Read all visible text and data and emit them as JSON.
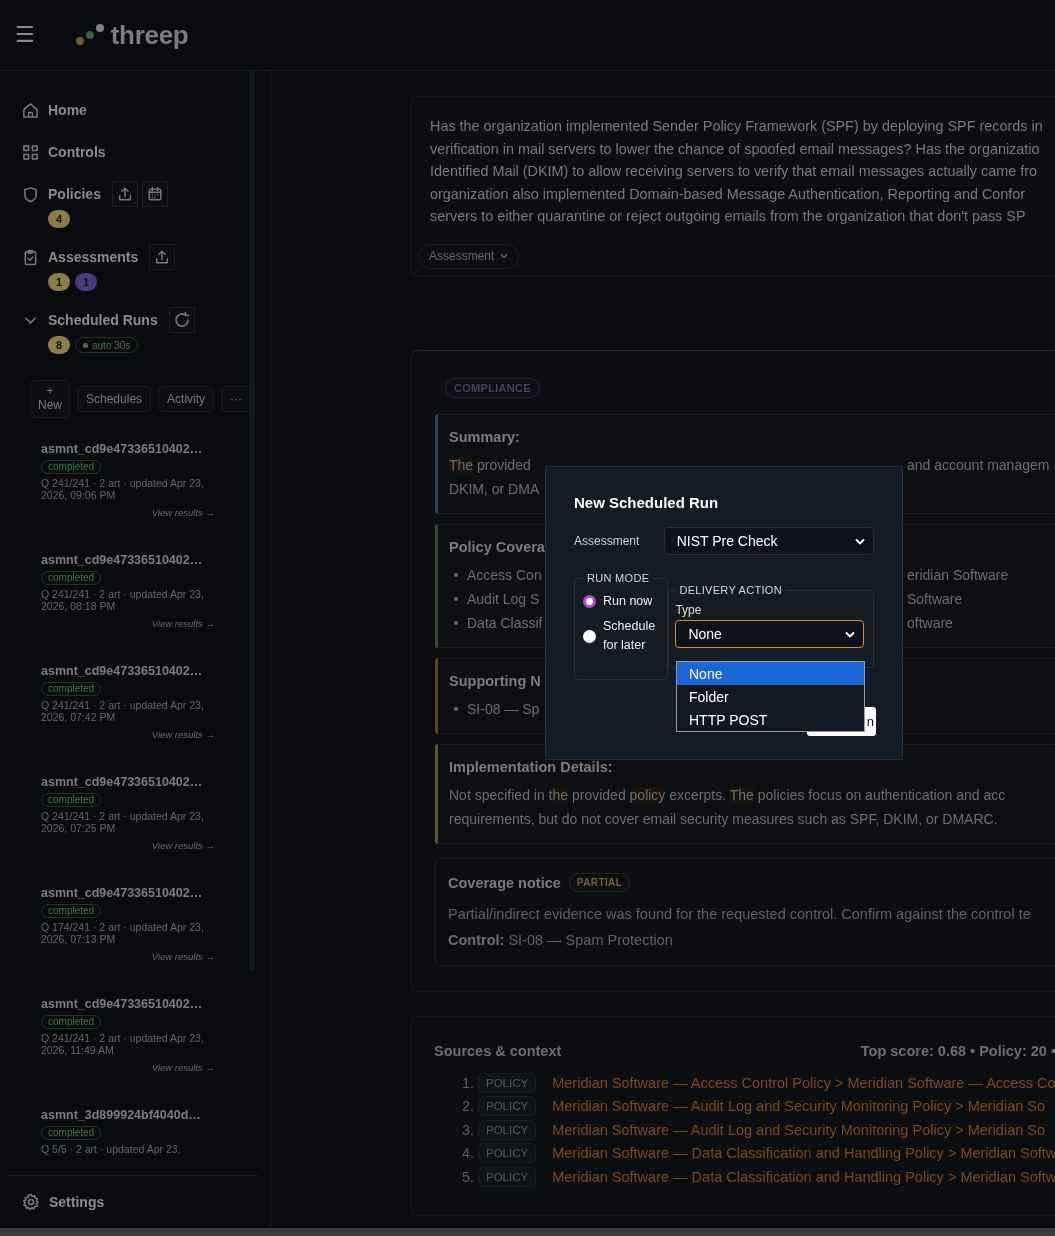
{
  "header": {
    "menu": "☰",
    "logo": "threep"
  },
  "sidebar": {
    "nav": [
      {
        "kind": "home",
        "label": "Home"
      },
      {
        "kind": "grid",
        "label": "Controls"
      },
      {
        "kind": "shield",
        "label": "Policies",
        "actions": [
          {
            "kind": "upload"
          },
          {
            "kind": "calendar"
          }
        ],
        "badges": [
          {
            "text": "4",
            "color": "#8c7c48"
          }
        ]
      },
      {
        "kind": "clipboard",
        "label": "Assessments",
        "actions": [
          {
            "kind": "upload"
          }
        ],
        "badges": [
          {
            "text": "1",
            "color": "#8c7c48"
          },
          {
            "text": "1",
            "color": "#4c3a7c"
          }
        ]
      },
      {
        "kind": "chevron",
        "label": "Scheduled Runs",
        "expanded": true,
        "actions": [
          {
            "kind": "refresh"
          }
        ],
        "badges": [
          {
            "text": "8",
            "color": "#8c7c48"
          }
        ],
        "status": "auto 30s"
      }
    ],
    "tabs": [
      {
        "icon": "+",
        "label": "New"
      },
      {
        "label": "Schedules"
      },
      {
        "label": "Activity"
      },
      {
        "label": "···"
      }
    ],
    "runs": [
      {
        "title": "asmnt_cd9e47336510402…",
        "status": "completed",
        "meta": "Q 241/241 · 2 art · updated Apr 23, 2026, 09:06 PM",
        "link": "View results →"
      },
      {
        "title": "asmnt_cd9e47336510402…",
        "status": "completed",
        "meta": "Q 241/241 · 2 art · updated Apr 23, 2026, 08:18 PM",
        "link": "View results →"
      },
      {
        "title": "asmnt_cd9e47336510402…",
        "status": "completed",
        "meta": "Q 241/241 · 2 art · updated Apr 23, 2026, 07:42 PM",
        "link": "View results →"
      },
      {
        "title": "asmnt_cd9e47336510402…",
        "status": "completed",
        "meta": "Q 241/241 · 2 art · updated Apr 23, 2026, 07:25 PM",
        "link": "View results →"
      },
      {
        "title": "asmnt_cd9e47336510402…",
        "status": "completed",
        "meta": "Q 174/241 · 2 art · updated Apr 23, 2026, 07:13 PM",
        "link": "View results →"
      },
      {
        "title": "asmnt_cd9e47336510402…",
        "status": "completed",
        "meta": "Q 241/241 · 2 art · updated Apr 23, 2026, 11:49 AM",
        "link": "View results →"
      },
      {
        "title": "asmnt_3d899924bf4040d…",
        "status": "completed",
        "meta": "Q 5/5 · 2 art · updated Apr 23,"
      }
    ],
    "settings": "Settings"
  },
  "question": {
    "lines": [
      "Has the organization implemented Sender Policy Framework (SPF) by deploying SPF records in",
      "verification in mail servers to lower the chance of spoofed email messages? Has the organizatio",
      "Identified Mail (DKIM) to allow receiving servers to verify that email messages actually came fro",
      "organization also implemented Domain-based Message Authentication, Reporting and Confor",
      "servers to either quarantine or reject outgoing emails from the organization that don't pass SP"
    ],
    "toggle": "Assessment"
  },
  "compliance": {
    "tag": "COMPLIANCE",
    "sections": [
      {
        "kind": "summary",
        "title": "Summary:",
        "color": "#2f4058",
        "lines": [
          {
            "segments": [
              {
                "text": "The",
                "highlighted": true
              },
              {
                "text": " provided",
                "highlighted": false
              }
            ],
            "right": "and account managem"
          },
          {
            "segments": [
              {
                "text": "DKIM, or DMA",
                "highlighted": false
              }
            ]
          }
        ]
      },
      {
        "kind": "bullets",
        "title": "Policy Covera",
        "color": "#3a4a30",
        "lines": [
          {
            "segments": [
              {
                "text": "Access Con",
                "highlighted": false
              }
            ],
            "right": "eridian Software"
          },
          {
            "segments": [
              {
                "text": "Audit Log S",
                "highlighted": false
              }
            ],
            "right": "Software"
          },
          {
            "segments": [
              {
                "text": "Data Classif",
                "highlighted": false
              }
            ],
            "right": "oftware"
          }
        ]
      },
      {
        "kind": "bullets",
        "title": "Supporting N",
        "color": "#5a4428",
        "lines": [
          {
            "segments": [
              {
                "text": "SI-08 — Sp",
                "highlighted": false
              }
            ]
          }
        ]
      },
      {
        "kind": "summary",
        "title": "Implementation Details:",
        "color": "#5e5530",
        "lines": [
          {
            "segments": [
              {
                "text": "Not specified in ",
                "highlighted": false
              },
              {
                "text": "the",
                "highlighted": true
              },
              {
                "text": " provided ",
                "highlighted": false
              },
              {
                "text": "policy",
                "highlighted": true
              },
              {
                "text": " excerpts. ",
                "highlighted": false
              },
              {
                "text": "The",
                "highlighted": true
              },
              {
                "text": " policies focus on authentication and acc",
                "highlighted": false
              }
            ]
          },
          {
            "segments": [
              {
                "text": "requirements, but do not cover email security measures such as SPF, DKIM, or DMARC.",
                "highlighted": false
              }
            ]
          }
        ]
      }
    ],
    "notice": {
      "title": "Coverage notice",
      "badge": "PARTIAL",
      "text": "Partial/indirect evidence was found for the requested control. Confirm against the control te",
      "control": "**Control:** SI-08 — Spam Protection"
    }
  },
  "sources": {
    "title": "Sources & context",
    "stats": "Top score: 0.68 • Policy: 20 •",
    "items": [
      {
        "number": "1.",
        "tag": "POLICY",
        "text": "Meridian Software — Access Control Policy > Meridian Software — Access Co"
      },
      {
        "number": "2.",
        "tag": "POLICY",
        "text": "Meridian Software — Audit Log and Security Monitoring Policy > Meridian So"
      },
      {
        "number": "3.",
        "tag": "POLICY",
        "text": "Meridian Software — Audit Log and Security Monitoring Policy > Meridian So"
      },
      {
        "number": "4.",
        "tag": "POLICY",
        "text": "Meridian Software — Data Classification and Handling Policy > Meridian Softw"
      },
      {
        "number": "5.",
        "tag": "POLICY",
        "text": "Meridian Software — Data Classification and Handling Policy > Meridian Softw"
      }
    ]
  },
  "modal": {
    "title": "New Scheduled Run",
    "assessment_label": "Assessment",
    "assessment_value": "NIST Pre Check",
    "run_mode": {
      "legend": "RUN MODE",
      "options": [
        {
          "label": "Run now",
          "selected": true
        },
        {
          "label": "Schedule for later",
          "selected": false
        }
      ]
    },
    "delivery": {
      "legend": "DELIVERY ACTION",
      "type_label": "Type",
      "type_value": "None",
      "focused": true,
      "open": true,
      "options": [
        {
          "label": "None",
          "selected": true
        },
        {
          "label": "Folder",
          "selected": false
        },
        {
          "label": "HTTP POST",
          "selected": false
        }
      ]
    },
    "submit": "n"
  }
}
